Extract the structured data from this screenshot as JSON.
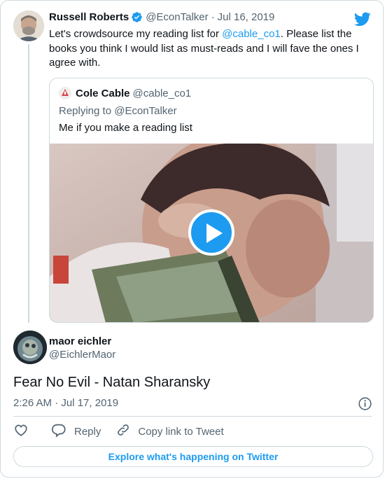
{
  "parent_tweet": {
    "author_name": "Russell Roberts",
    "handle": "@EconTalker",
    "separator": "·",
    "date": "Jul 16, 2019",
    "text_before": "Let's crowdsource my reading list for ",
    "mention": "@cable_co1",
    "text_after": ". Please list the books you think I would list as must-reads and I will fave the ones I agree with."
  },
  "quoted_tweet": {
    "author_name": "Cole Cable",
    "handle": "@cable_co1",
    "replying_to": "Replying to @EconTalker",
    "text": "Me if you make a reading list"
  },
  "reply_tweet": {
    "author_name": "maor eichler",
    "handle": "@EichlerMaor",
    "text": "Fear No Evil - Natan Sharansky",
    "timestamp": "2:26 AM · Jul 17, 2019"
  },
  "actions": {
    "reply_label": "Reply",
    "copy_link_label": "Copy link to Tweet"
  },
  "explore_label": "Explore what's happening on Twitter",
  "icons": [
    "verified-badge-icon",
    "twitter-bird-icon",
    "play-icon",
    "info-icon",
    "heart-icon",
    "reply-icon",
    "link-icon"
  ],
  "colors": {
    "accent": "#1d9bf0",
    "text": "#0f1419",
    "muted": "#536471",
    "border": "#cfd9de"
  }
}
